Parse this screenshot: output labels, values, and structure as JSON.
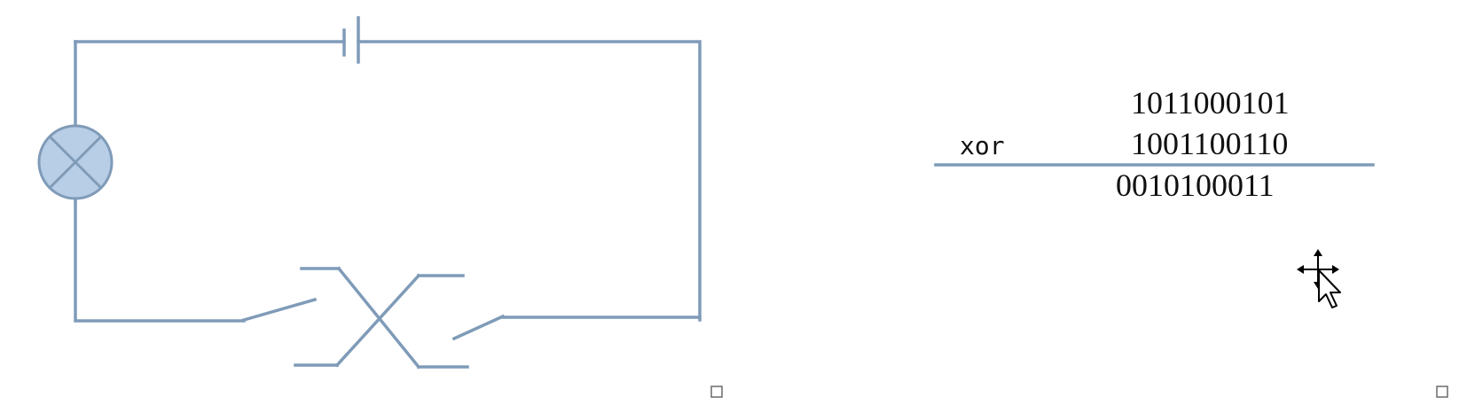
{
  "xor": {
    "operator_label": "xor",
    "operand_a": "1011000101",
    "operand_b": "1001100110",
    "result": "0010100011"
  },
  "icons": {
    "lamp": "lamp-icon",
    "battery": "battery-icon",
    "switch_left": "switch-icon",
    "switch_right": "switch-icon",
    "crossed_contacts": "crossed-switch-icon",
    "cursor": "move-cursor-icon",
    "resize_handle": "resize-handle-icon"
  },
  "colors": {
    "wire": "#7f9bb8",
    "lamp_fill": "#b8cde6",
    "lamp_stroke": "#7f9bb8"
  }
}
